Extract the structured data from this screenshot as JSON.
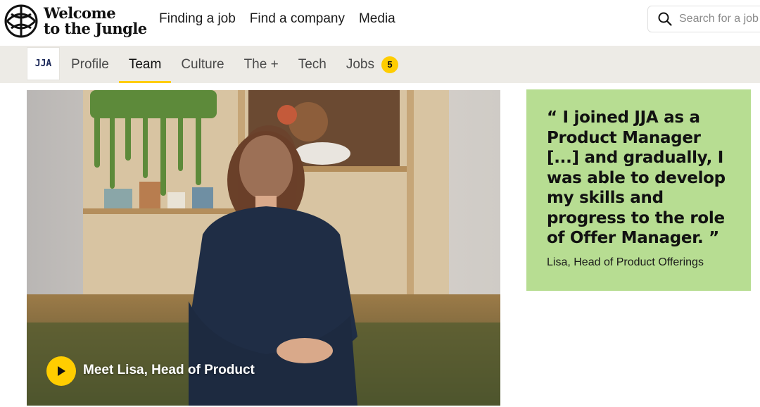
{
  "brand": {
    "logo_line1": "Welcome",
    "logo_line2": "to the Jungle"
  },
  "main_nav": {
    "items": [
      "Finding a job",
      "Find a company",
      "Media"
    ]
  },
  "search": {
    "placeholder": "Search for a job"
  },
  "company": {
    "logo_text": "JJA",
    "tabs": [
      {
        "label": "Profile"
      },
      {
        "label": "Team",
        "active": true
      },
      {
        "label": "Culture"
      },
      {
        "label": "The +"
      },
      {
        "label": "Tech"
      },
      {
        "label": "Jobs",
        "badge": "5"
      }
    ]
  },
  "hero": {
    "caption": "Meet Lisa, Head of Product",
    "play_icon": "play-icon"
  },
  "quote": {
    "text": "“ I joined JJA as a Product Manager [...] and gradually, I was able to develop my skills and progress to the role of Offer Manager. ”",
    "author": "Lisa, Head of Product Offerings"
  },
  "colors": {
    "accent_yellow": "#ffcd00",
    "quote_bg": "#b7dd92",
    "company_nav_bg": "#edebe6"
  }
}
